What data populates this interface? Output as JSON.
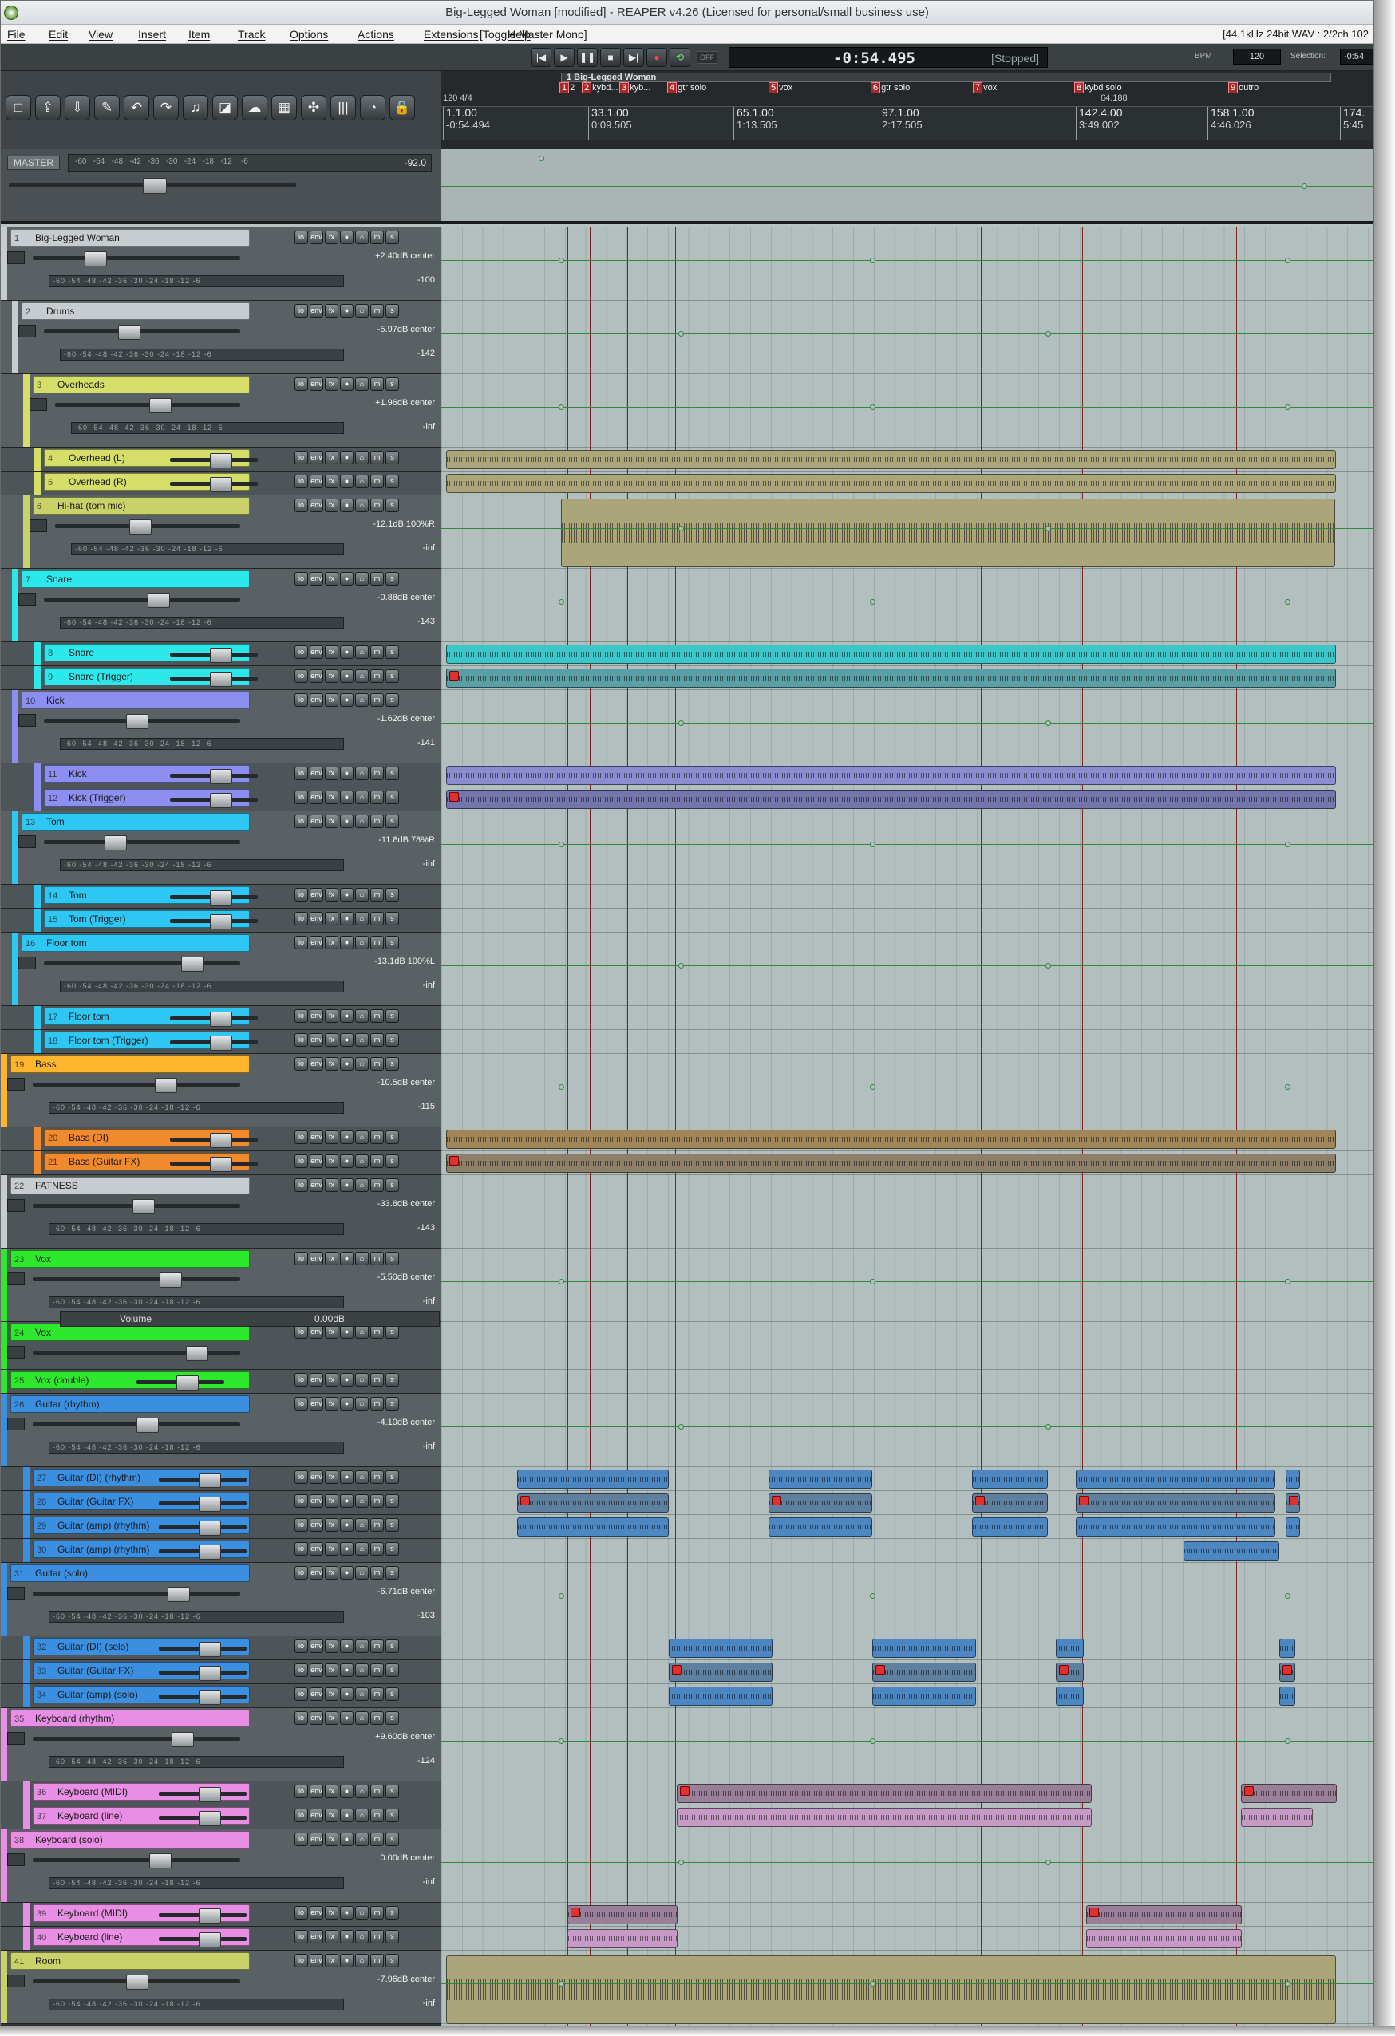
{
  "window": {
    "title": "Big-Legged Woman [modified] - REAPER v4.26 (Licensed for personal/small business use)"
  },
  "menu": {
    "items": [
      "File",
      "Edit",
      "View",
      "Insert",
      "Item",
      "Track",
      "Options",
      "Actions",
      "Extensions",
      "Help"
    ],
    "toggle_label": "[Toggle Master Mono]",
    "status_text": "[44.1kHz 24bit WAV : 2/2ch 102"
  },
  "transport": {
    "buttons": [
      "|◀",
      "▶",
      "❚❚",
      "■",
      "▶|",
      "●",
      "⟲"
    ],
    "off_label": "OFF",
    "time": "-0:54.495",
    "state": "[Stopped]",
    "bpm_label": "BPM",
    "bpm_value": "120",
    "selection_label": "Selection:",
    "selection_value": "-0:54"
  },
  "toolbar": {
    "icons": [
      "new-icon",
      "open-icon",
      "save-icon",
      "wrench-icon",
      "undo-icon",
      "redo-icon",
      "metronome-icon",
      "mix-icon",
      "cloud-icon",
      "grid-icon",
      "grid-snap-icon",
      "mixer-icon",
      "headphones-icon",
      "lock-icon"
    ],
    "glyphs": [
      "□",
      "⇪",
      "⇩",
      "✎",
      "↶",
      "↷",
      "♫",
      "◪",
      "☁",
      "▦",
      "✣",
      "|||",
      "◔",
      "🔒"
    ]
  },
  "ruler": {
    "region_label": "1 Big-Legged Woman",
    "markers": [
      {
        "num": "1",
        "label": "2"
      },
      {
        "num": "2",
        "label": "kybd..."
      },
      {
        "num": "3",
        "label": "kyb..."
      },
      {
        "num": "4",
        "label": "gtr solo"
      },
      {
        "num": "5",
        "label": "vox"
      },
      {
        "num": "6",
        "label": "gtr solo"
      },
      {
        "num": "7",
        "label": "vox"
      },
      {
        "num": "8",
        "label": "kybd solo"
      },
      {
        "num": "9",
        "label": "outro"
      }
    ],
    "tempo_left": "120 4/4",
    "tempo_right": "64.188",
    "ticks": [
      {
        "bar": "1.1.00",
        "time": "-0:54.494"
      },
      {
        "bar": "33.1.00",
        "time": "0:09.505"
      },
      {
        "bar": "65.1.00",
        "time": "1:13.505"
      },
      {
        "bar": "97.1.00",
        "time": "2:17.505"
      },
      {
        "bar": "142.4.00",
        "time": "3:49.002"
      },
      {
        "bar": "158.1.00",
        "time": "4:46.026"
      },
      {
        "bar": "174.",
        "time": "5:45"
      }
    ]
  },
  "master": {
    "label": "MASTER",
    "scale": "-60   -54   -48   -42   -36   -30   -24   -18   -12    -6",
    "peak": "-92.0"
  },
  "scale_text": "-60  -54  -48  -42  -36  -30  -24  -18  -12   -6",
  "tracks": [
    {
      "num": "1",
      "name": "Big-Legged Woman",
      "vol": "+2.40dB center",
      "peak": "-100",
      "color": "#c7ccd0",
      "depth": 0,
      "folder": true
    },
    {
      "num": "2",
      "name": "Drums",
      "vol": "-5.97dB center",
      "peak": "-142",
      "color": "#c7ccd0",
      "depth": 1,
      "folder": true
    },
    {
      "num": "3",
      "name": "Overheads",
      "vol": "+1.96dB center",
      "peak": "-inf",
      "color": "#d6de6a",
      "depth": 2,
      "folder": true
    },
    {
      "num": "4",
      "name": "Overhead (L)",
      "color": "#d6de6a",
      "depth": 3,
      "folder": false
    },
    {
      "num": "5",
      "name": "Overhead (R)",
      "color": "#d6de6a",
      "depth": 3,
      "folder": false
    },
    {
      "num": "6",
      "name": "Hi-hat (tom mic)",
      "vol": "-12.1dB 100%R",
      "peak": "-inf",
      "color": "#c9d169",
      "depth": 2,
      "folder": true
    },
    {
      "num": "7",
      "name": "Snare",
      "vol": "-0.88dB center",
      "peak": "-143",
      "color": "#2de8ea",
      "depth": 1,
      "folder": true
    },
    {
      "num": "8",
      "name": "Snare",
      "color": "#2de8ea",
      "depth": 3,
      "folder": false
    },
    {
      "num": "9",
      "name": "Snare (Trigger)",
      "color": "#2de8ea",
      "depth": 3,
      "folder": false
    },
    {
      "num": "10",
      "name": "Kick",
      "vol": "-1.62dB center",
      "peak": "-141",
      "color": "#8c8ef0",
      "depth": 1,
      "folder": true
    },
    {
      "num": "11",
      "name": "Kick",
      "color": "#8c8ef0",
      "depth": 3,
      "folder": false
    },
    {
      "num": "12",
      "name": "Kick (Trigger)",
      "color": "#8c8ef0",
      "depth": 3,
      "folder": false
    },
    {
      "num": "13",
      "name": "Tom",
      "vol": "-11.8dB 78%R",
      "peak": "-inf",
      "color": "#2ec7f4",
      "depth": 1,
      "folder": true
    },
    {
      "num": "14",
      "name": "Tom",
      "color": "#2ec7f4",
      "depth": 3,
      "folder": false
    },
    {
      "num": "15",
      "name": "Tom (Trigger)",
      "color": "#2ec7f4",
      "depth": 3,
      "folder": false
    },
    {
      "num": "16",
      "name": "Floor tom",
      "vol": "-13.1dB 100%L",
      "peak": "-inf",
      "color": "#2ec7f4",
      "depth": 1,
      "folder": true
    },
    {
      "num": "17",
      "name": "Floor tom",
      "color": "#2ec7f4",
      "depth": 3,
      "folder": false
    },
    {
      "num": "18",
      "name": "Floor tom (Trigger)",
      "color": "#2ec7f4",
      "depth": 3,
      "folder": false
    },
    {
      "num": "19",
      "name": "Bass",
      "vol": "-10.5dB center",
      "peak": "-115",
      "color": "#fdb52d",
      "depth": 0,
      "folder": true
    },
    {
      "num": "20",
      "name": "Bass (DI)",
      "color": "#f08a2d",
      "depth": 3,
      "folder": false
    },
    {
      "num": "21",
      "name": "Bass (Guitar FX)",
      "color": "#f08a2d",
      "depth": 3,
      "folder": false
    },
    {
      "num": "22",
      "name": "FATNESS",
      "vol": "-33.8dB center",
      "peak": "-143",
      "color": "#c7ccd0",
      "depth": 0,
      "folder": false
    },
    {
      "num": "23",
      "name": "Vox",
      "vol": "-5.50dB center",
      "peak": "-inf",
      "color": "#2ee82e",
      "depth": 0,
      "folder": true
    },
    {
      "num": "24",
      "name": "Vox",
      "color": "#2ee82e",
      "depth": 0,
      "folder": false
    },
    {
      "num": "25",
      "name": "Vox (double)",
      "color": "#2ee82e",
      "depth": 0,
      "folder": false
    },
    {
      "num": "26",
      "name": "Guitar (rhythm)",
      "vol": "-4.10dB center",
      "peak": "-inf",
      "color": "#3a8fe0",
      "depth": 0,
      "folder": true
    },
    {
      "num": "27",
      "name": "Guitar (DI) (rhythm)",
      "color": "#3a8fe0",
      "depth": 2,
      "folder": false
    },
    {
      "num": "28",
      "name": "Guitar (Guitar FX)",
      "color": "#3a8fe0",
      "depth": 2,
      "folder": false
    },
    {
      "num": "29",
      "name": "Guitar (amp) (rhythm)",
      "color": "#3a8fe0",
      "depth": 2,
      "folder": false
    },
    {
      "num": "30",
      "name": "Guitar (amp) (rhythm)",
      "color": "#3a8fe0",
      "depth": 2,
      "folder": false
    },
    {
      "num": "31",
      "name": "Guitar (solo)",
      "vol": "-6.71dB center",
      "peak": "-103",
      "color": "#3a8fe0",
      "depth": 0,
      "folder": true
    },
    {
      "num": "32",
      "name": "Guitar (DI) (solo)",
      "color": "#3a8fe0",
      "depth": 2,
      "folder": false
    },
    {
      "num": "33",
      "name": "Guitar (Guitar FX)",
      "color": "#3a8fe0",
      "depth": 2,
      "folder": false
    },
    {
      "num": "34",
      "name": "Guitar (amp) (solo)",
      "color": "#3a8fe0",
      "depth": 2,
      "folder": false
    },
    {
      "num": "35",
      "name": "Keyboard (rhythm)",
      "vol": "+9.60dB center",
      "peak": "-124",
      "color": "#e88ee4",
      "depth": 0,
      "folder": true
    },
    {
      "num": "36",
      "name": "Keyboard (MIDI)",
      "color": "#e88ee4",
      "depth": 2,
      "folder": false
    },
    {
      "num": "37",
      "name": "Keyboard (line)",
      "color": "#e88ee4",
      "depth": 2,
      "folder": false
    },
    {
      "num": "38",
      "name": "Keyboard (solo)",
      "vol": "0.00dB center",
      "peak": "-inf",
      "color": "#e88ee4",
      "depth": 0,
      "folder": true
    },
    {
      "num": "39",
      "name": "Keyboard (MIDI)",
      "color": "#e88ee4",
      "depth": 2,
      "folder": false
    },
    {
      "num": "40",
      "name": "Keyboard (line)",
      "color": "#e88ee4",
      "depth": 2,
      "folder": false
    },
    {
      "num": "41",
      "name": "Room",
      "vol": "-7.96dB center",
      "peak": "-inf",
      "color": "#c9d169",
      "depth": 0,
      "folder": true
    }
  ],
  "envelope_panel": {
    "name": "Volume",
    "value": "0.00dB"
  },
  "tcp_buttons": [
    "io",
    "env",
    "fx",
    "●",
    "⌂",
    "m",
    "s"
  ]
}
